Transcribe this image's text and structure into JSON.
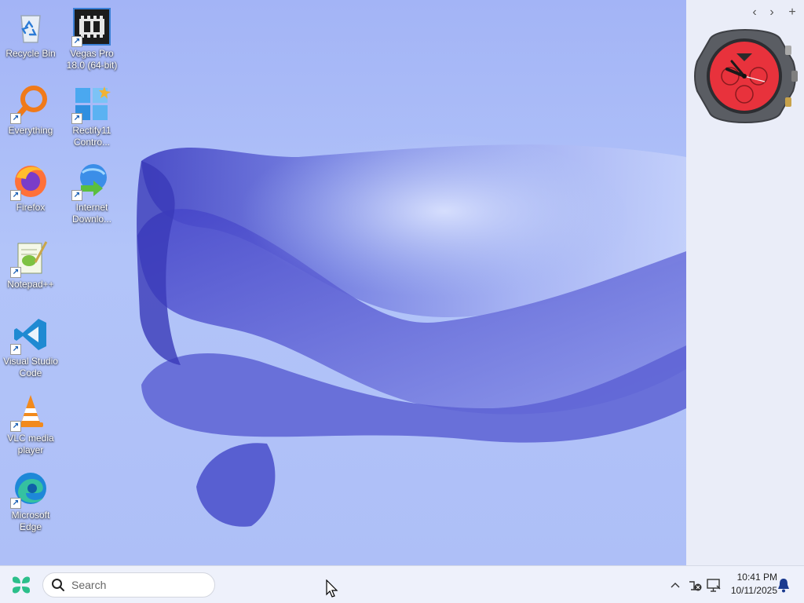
{
  "desktop": {
    "icons": [
      {
        "label": "Recycle Bin",
        "icon": "recycle-bin-icon"
      },
      {
        "label": "Vegas Pro 18.0 (64-bit)",
        "icon": "vegas-pro-icon"
      },
      {
        "label": "Everything",
        "icon": "everything-search-icon"
      },
      {
        "label": "Rectify11 Contro...",
        "icon": "rectify11-icon"
      },
      {
        "label": "Firefox",
        "icon": "firefox-icon"
      },
      {
        "label": "Internet Downlo...",
        "icon": "internet-download-manager-icon"
      },
      {
        "label": "Notepad++",
        "icon": "notepad-plus-plus-icon"
      },
      {
        "label": "Visual Studio Code",
        "icon": "vscode-icon"
      },
      {
        "label": "VLC media player",
        "icon": "vlc-icon"
      },
      {
        "label": "Microsoft Edge",
        "icon": "edge-icon"
      }
    ]
  },
  "side_panel": {
    "prev_label": "‹",
    "next_label": "›",
    "add_label": "+",
    "widget": "analog-watch-gadget"
  },
  "taskbar": {
    "search": {
      "placeholder": "Search"
    },
    "tray": {
      "overflow_label": "^",
      "time": "10:41 PM",
      "date": "10/11/2025"
    }
  },
  "colors": {
    "wallpaper": "#a9bcf4",
    "ribbon_dark": "#3f3fc4",
    "taskbar": "#eef1fb",
    "watch_face": "#e8323c"
  }
}
